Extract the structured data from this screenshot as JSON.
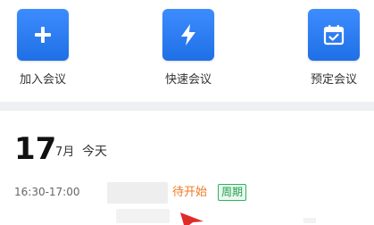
{
  "actions": [
    {
      "label": "加入会议",
      "icon": "plus-icon"
    },
    {
      "label": "快速会议",
      "icon": "lightning-icon"
    },
    {
      "label": "预定会议",
      "icon": "calendar-check-icon"
    }
  ],
  "date": {
    "day": "17",
    "month": "7月",
    "today": "今天"
  },
  "meeting": {
    "time": "16:30-17:00",
    "status": "待开始",
    "badge": "周期"
  },
  "colors": {
    "accent_blue": "#2a7cf5",
    "status_orange": "#f07a22",
    "badge_green": "#22a04d",
    "cursor_red": "#e02b2b"
  }
}
